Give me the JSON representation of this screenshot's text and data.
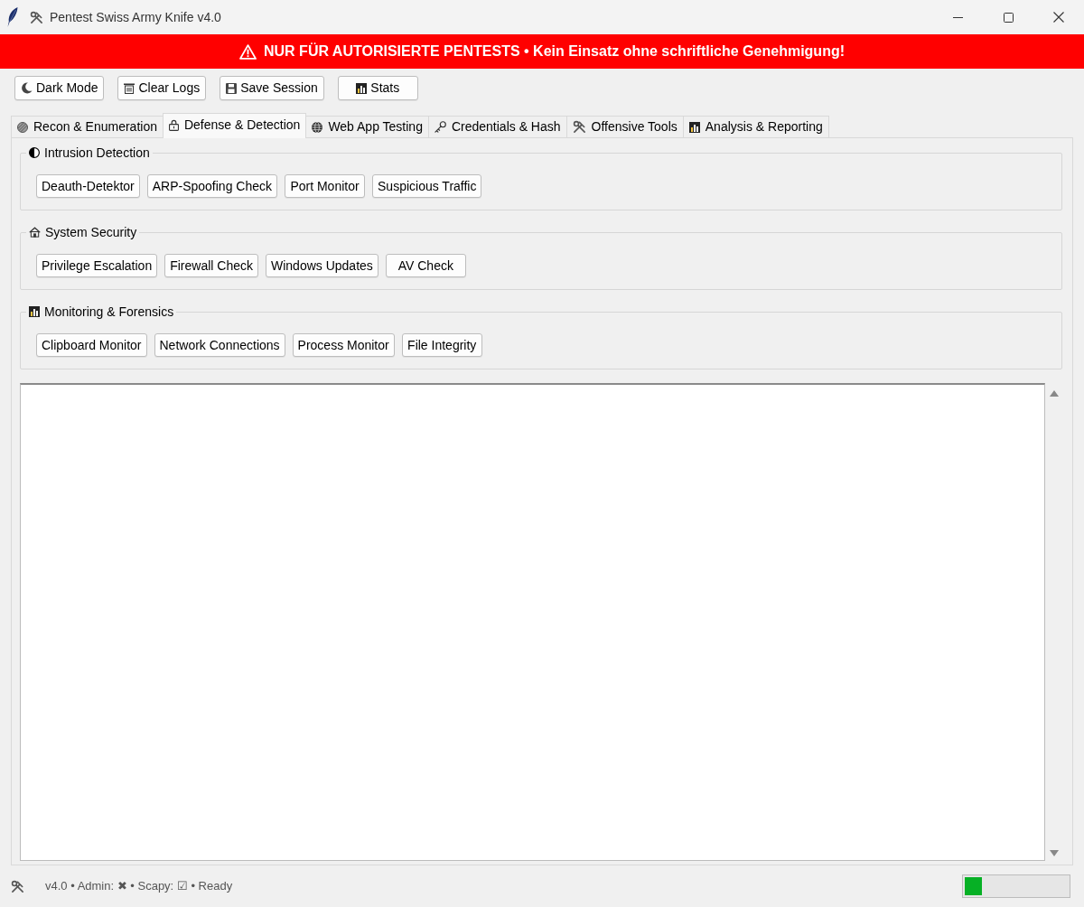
{
  "window": {
    "title": "Pentest Swiss Army Knife v4.0"
  },
  "banner": {
    "text": "NUR FÜR AUTORISIERTE PENTESTS • Kein Einsatz ohne schriftliche Genehmigung!"
  },
  "toolbar": {
    "buttons": [
      "Dark Mode",
      "Clear Logs",
      "Save Session",
      "Stats"
    ]
  },
  "tabs": [
    {
      "label": "Recon & Enumeration",
      "selected": false
    },
    {
      "label": "Defense & Detection",
      "selected": true
    },
    {
      "label": "Web App Testing",
      "selected": false
    },
    {
      "label": "Credentials & Hash",
      "selected": false
    },
    {
      "label": "Offensive Tools",
      "selected": false
    },
    {
      "label": "Analysis & Reporting",
      "selected": false
    }
  ],
  "sections": [
    {
      "title": "Intrusion Detection",
      "buttons": [
        "Deauth-Detektor",
        "ARP-Spoofing Check",
        "Port Monitor",
        "Suspicious Traffic"
      ]
    },
    {
      "title": "System Security",
      "buttons": [
        "Privilege Escalation",
        "Firewall Check",
        "Windows Updates",
        "AV Check"
      ]
    },
    {
      "title": "Monitoring & Forensics",
      "buttons": [
        "Clipboard Monitor",
        "Network Connections",
        "Process Monitor",
        "File Integrity"
      ]
    }
  ],
  "status_bar": {
    "text": "v4.0 • Admin: ✖ • Scapy: ☑ • Ready",
    "progress": {
      "level": 0.17
    }
  }
}
